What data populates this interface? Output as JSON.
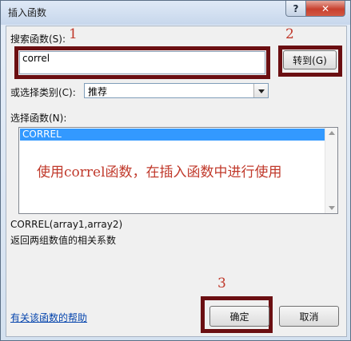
{
  "dialog": {
    "title": "插入函数",
    "help_glyph": "?",
    "close_glyph": "✕"
  },
  "search": {
    "label": "搜索函数(S):",
    "value": "correl",
    "go_label": "转到(G)"
  },
  "category": {
    "label": "或选择类别(C):",
    "selected": "推荐"
  },
  "function_list": {
    "label": "选择函数(N):",
    "items": [
      "CORREL"
    ]
  },
  "description": {
    "signature": "CORREL(array1,array2)",
    "text": "返回两组数值的相关系数"
  },
  "footer": {
    "help_link": "有关该函数的帮助",
    "ok_label": "确定",
    "cancel_label": "取消"
  },
  "annotations": {
    "step1": "1",
    "step2": "2",
    "step3": "3",
    "note": "使用correl函数，在插入函数中进行使用"
  },
  "colors": {
    "highlight_border": "#6b0f12",
    "annotation_text": "#c0392b",
    "selection": "#3399ff"
  }
}
